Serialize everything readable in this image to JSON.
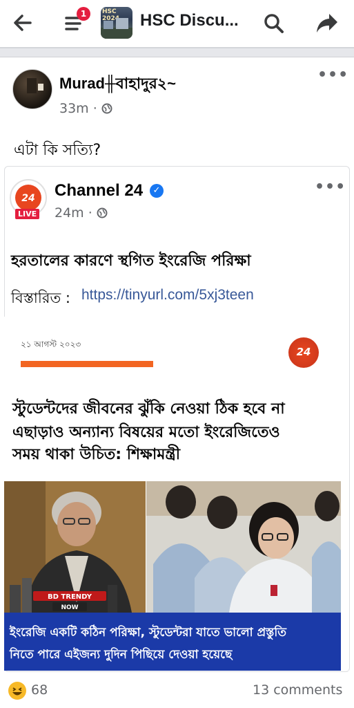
{
  "header": {
    "notification_count": "1",
    "group_thumb_text": "HSC 2024",
    "group_title": "HSC Discu..."
  },
  "post": {
    "author": "Murad╫বাহাদুর২~",
    "time": "33m ·",
    "text": "এটা কি সত্যি?"
  },
  "shared": {
    "page_name": "Channel 24",
    "logo_text": "24",
    "live_label": "LIVE",
    "time": "24m ·",
    "headline": "হরতালের কারণে স্থগিত ইংরেজি পরিক্ষা",
    "detail_label": "বিস্তারিত :",
    "detail_link": "https://tinyurl.com/5xj3teen"
  },
  "article": {
    "date": "২১ আগস্ট ২০২৩",
    "logo_text": "24",
    "line1": "স্টুডেন্টদের জীবনের ঝুঁকি নেওয়া ঠিক হবে না",
    "line2": "এছাড়াও অন্যান্য বিষয়ের মতো ইংরেজিতেও",
    "line3": "সময় থাকা উচিত: শিক্ষামন্ত্রী",
    "watermark1": "BD TRENDY",
    "watermark2": "NOW",
    "caption1": "ইংরেজি একটি কঠিন পরিক্ষা, স্টুডেন্টরা যাতে ভালো প্রস্তুতি",
    "caption2": "নিতে পারে এইজন্য দুদিন পিছিয়ে দেওয়া হয়েছে"
  },
  "footer": {
    "reaction_icon": "haha-emoji-icon",
    "reaction_count": "68",
    "comments": "13 comments"
  },
  "colors": {
    "accent": "#1877f2",
    "badge": "#e41e3f",
    "link": "#385898",
    "caption_bg": "#1b3aa8",
    "brand_orange": "#f26522"
  }
}
